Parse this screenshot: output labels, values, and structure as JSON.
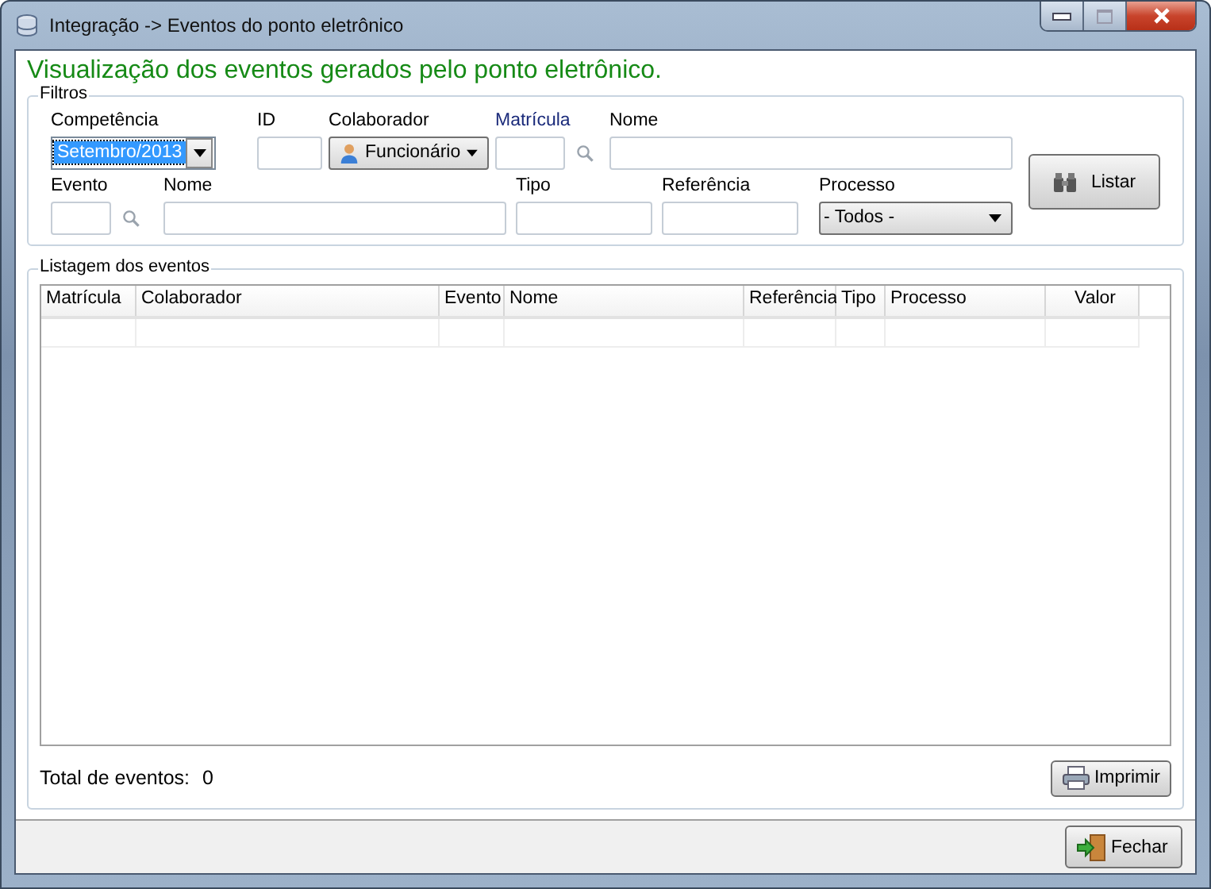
{
  "window": {
    "title": "Integração -> Eventos do ponto eletrônico"
  },
  "heading": "Visualização dos eventos gerados pelo ponto eletrônico.",
  "filters": {
    "title": "Filtros",
    "rows": [
      {
        "fields": [
          {
            "kind": "combo",
            "label": "Competência",
            "value": "Setembro/2013",
            "selected": true,
            "emphasized": false
          },
          {
            "kind": "text",
            "label": "ID",
            "emphasized": false
          },
          {
            "kind": "menu",
            "label": "Colaborador",
            "value": "Funcionário",
            "emphasized": false
          },
          {
            "kind": "search",
            "label": "Matrícula",
            "emphasized": true
          },
          {
            "kind": "text",
            "label": "Nome",
            "emphasized": false
          }
        ]
      },
      {
        "fields": [
          {
            "kind": "search",
            "label": "Evento",
            "emphasized": false
          },
          {
            "kind": "text",
            "label": "Nome",
            "emphasized": false
          },
          {
            "kind": "text",
            "label": "Tipo",
            "emphasized": false
          },
          {
            "kind": "text",
            "label": "Referência",
            "emphasized": false
          },
          {
            "kind": "select",
            "label": "Processo",
            "value": "- Todos -",
            "emphasized": false
          }
        ]
      }
    ],
    "button": "Listar"
  },
  "listing": {
    "title": "Listagem dos eventos",
    "columns": [
      "Matrícula",
      "Colaborador",
      "Evento",
      "Nome",
      "Referência",
      "Tipo",
      "Processo",
      "Valor"
    ]
  },
  "total": {
    "label": "Total de eventos:",
    "value": "0"
  },
  "print_button": "Imprimir",
  "close_button": "Fechar"
}
